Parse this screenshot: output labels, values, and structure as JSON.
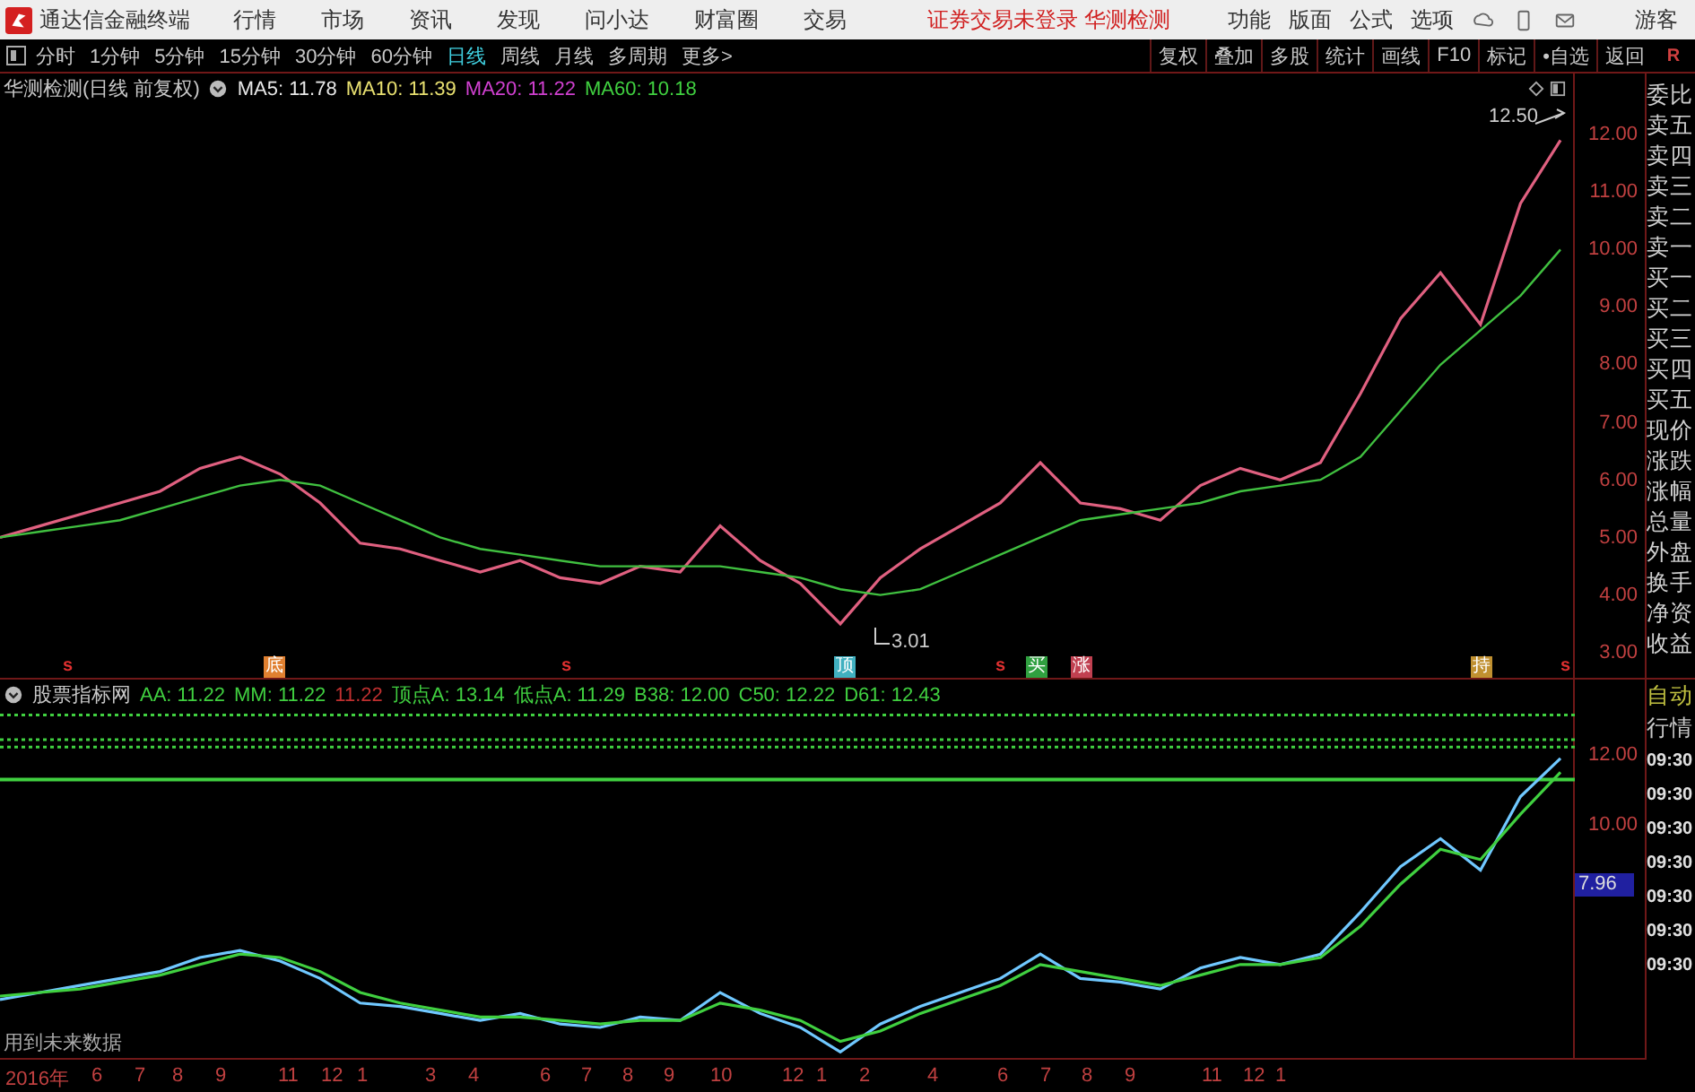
{
  "app": {
    "title": "通达信金融终端",
    "menus": [
      "行情",
      "市场",
      "资讯",
      "发现",
      "问小达",
      "财富圈",
      "交易"
    ],
    "notice": "证券交易未登录 华测检测",
    "tools": [
      "功能",
      "版面",
      "公式",
      "选项"
    ],
    "user": "游客"
  },
  "periods": [
    {
      "label": "分时",
      "selected": false
    },
    {
      "label": "1分钟",
      "selected": false
    },
    {
      "label": "5分钟",
      "selected": false
    },
    {
      "label": "15分钟",
      "selected": false
    },
    {
      "label": "30分钟",
      "selected": false
    },
    {
      "label": "60分钟",
      "selected": false
    },
    {
      "label": "日线",
      "selected": true
    },
    {
      "label": "周线",
      "selected": false
    },
    {
      "label": "月线",
      "selected": false
    },
    {
      "label": "多周期",
      "selected": false
    },
    {
      "label": "更多>",
      "selected": false
    }
  ],
  "actions": [
    "复权",
    "叠加",
    "多股",
    "统计",
    "画线",
    "F10",
    "标记",
    "•自选",
    "返回"
  ],
  "main_chart": {
    "title": "华测检测(日线 前复权)",
    "indicators": [
      {
        "text": "MA5: 11.78",
        "color": "#e8e8e8"
      },
      {
        "text": "MA10: 11.39",
        "color": "#e8e070"
      },
      {
        "text": "MA20: 11.22",
        "color": "#d040d0"
      },
      {
        "text": "MA60: 10.18",
        "color": "#40d040"
      }
    ],
    "high_label": "12.50",
    "low_label": "3.01",
    "signals": [
      {
        "text": "s",
        "kind": "mark",
        "color": "#e03030"
      },
      {
        "text": "底",
        "kind": "box",
        "color": "#e08030"
      },
      {
        "text": "s",
        "kind": "mark",
        "color": "#e03030"
      },
      {
        "text": "顶",
        "kind": "box",
        "color": "#40b0c0"
      },
      {
        "text": "s",
        "kind": "mark",
        "color": "#e03030"
      },
      {
        "text": "买",
        "kind": "box",
        "color": "#30a040"
      },
      {
        "text": "涨",
        "kind": "box",
        "color": "#c04050"
      },
      {
        "text": "持",
        "kind": "box",
        "color": "#c09030"
      },
      {
        "text": "s",
        "kind": "mark",
        "color": "#e03030"
      }
    ],
    "chart_data": {
      "type": "line",
      "ylim": [
        2.53,
        13.06
      ],
      "yticks": [
        {
          "value": 3,
          "label": "3.00"
        },
        {
          "value": 4,
          "label": "4.00"
        },
        {
          "value": 5,
          "label": "5.00"
        },
        {
          "value": 6,
          "label": "6.00"
        },
        {
          "value": 7,
          "label": "7.00"
        },
        {
          "value": 8,
          "label": "8.00"
        },
        {
          "value": 9,
          "label": "9.00"
        },
        {
          "value": 10,
          "label": "10.00"
        },
        {
          "value": 11,
          "label": "11.00"
        },
        {
          "value": 12,
          "label": "12.00"
        }
      ],
      "series": [
        {
          "color": "#e06080",
          "values": [
            5.0,
            5.2,
            5.4,
            5.6,
            5.8,
            6.2,
            6.4,
            6.1,
            5.6,
            4.9,
            4.8,
            4.6,
            4.4,
            4.6,
            4.3,
            4.2,
            4.5,
            4.4,
            5.2,
            4.6,
            4.2,
            3.5,
            4.3,
            4.8,
            5.2,
            5.6,
            6.3,
            5.6,
            5.5,
            5.3,
            5.9,
            6.2,
            6.0,
            6.3,
            7.5,
            8.8,
            9.6,
            8.7,
            10.8,
            11.9
          ]
        },
        {
          "color": "#40c040",
          "values": [
            5.0,
            5.1,
            5.2,
            5.3,
            5.5,
            5.7,
            5.9,
            6.0,
            5.9,
            5.6,
            5.3,
            5.0,
            4.8,
            4.7,
            4.6,
            4.5,
            4.5,
            4.5,
            4.5,
            4.4,
            4.3,
            4.1,
            4.0,
            4.1,
            4.4,
            4.7,
            5.0,
            5.3,
            5.4,
            5.5,
            5.6,
            5.8,
            5.9,
            6.0,
            6.4,
            7.2,
            8.0,
            8.6,
            9.2,
            10.0
          ]
        }
      ]
    }
  },
  "indicator": {
    "name": "股票指标网",
    "values": [
      {
        "text": "AA: 11.22",
        "color": "#40d040"
      },
      {
        "text": "MM: 11.22",
        "color": "#40d040"
      },
      {
        "text": "11.22",
        "color": "#c03030"
      },
      {
        "text": "顶点A: 13.14",
        "color": "#40d040"
      },
      {
        "text": "低点A: 11.29",
        "color": "#40d040"
      },
      {
        "text": "B38: 12.00",
        "color": "#40d040"
      },
      {
        "text": "C50: 12.22",
        "color": "#40d040"
      },
      {
        "text": "D61: 12.43",
        "color": "#40d040"
      }
    ],
    "note": "用到未来数据",
    "price_tag": "7.96",
    "chart_data": {
      "type": "line",
      "ylim": [
        3.33,
        14.15
      ],
      "yticks": [
        {
          "value": 10,
          "label": "10.00"
        },
        {
          "value": 12,
          "label": "12.00"
        }
      ],
      "series": [
        {
          "color": "#70c8ff",
          "values": [
            5.0,
            5.2,
            5.4,
            5.6,
            5.8,
            6.2,
            6.4,
            6.1,
            5.6,
            4.9,
            4.8,
            4.6,
            4.4,
            4.6,
            4.3,
            4.2,
            4.5,
            4.4,
            5.2,
            4.6,
            4.2,
            3.5,
            4.3,
            4.8,
            5.2,
            5.6,
            6.3,
            5.6,
            5.5,
            5.3,
            5.9,
            6.2,
            6.0,
            6.3,
            7.5,
            8.8,
            9.6,
            8.7,
            10.8,
            11.9
          ]
        },
        {
          "color": "#40d040",
          "values": [
            5.1,
            5.2,
            5.3,
            5.5,
            5.7,
            6.0,
            6.3,
            6.2,
            5.8,
            5.2,
            4.9,
            4.7,
            4.5,
            4.5,
            4.4,
            4.3,
            4.4,
            4.4,
            4.9,
            4.7,
            4.4,
            3.8,
            4.1,
            4.6,
            5.0,
            5.4,
            6.0,
            5.8,
            5.6,
            5.4,
            5.7,
            6.0,
            6.0,
            6.2,
            7.1,
            8.3,
            9.3,
            9.0,
            10.3,
            11.5
          ]
        }
      ],
      "ref_lines": [
        {
          "axis": "y",
          "value": 13.14
        },
        {
          "axis": "y",
          "value": 12.43
        },
        {
          "axis": "y",
          "value": 12.22
        },
        {
          "axis": "y",
          "value": 11.29
        }
      ]
    }
  },
  "x_axis": [
    "2016年",
    "6",
    "7",
    "8",
    "9",
    "11",
    "12",
    "1",
    "3",
    "4",
    "6",
    "7",
    "8",
    "9",
    "10",
    "12",
    "1",
    "2",
    "4",
    "6",
    "7",
    "8",
    "9",
    "11",
    "12",
    "1"
  ],
  "side_panel": {
    "top": "R",
    "quote_labels": [
      "委比",
      "卖五",
      "卖四",
      "卖三",
      "卖二",
      "卖一",
      "买一",
      "买二",
      "买三",
      "买四",
      "买五",
      "现价",
      "涨跌",
      "涨幅",
      "总量",
      "外盘",
      "换手",
      "净资",
      "收益"
    ],
    "modes": [
      "自动",
      "行情"
    ],
    "times": [
      "09:30",
      "09:30",
      "09:30",
      "09:30",
      "09:30",
      "09:30",
      "09:30"
    ]
  }
}
